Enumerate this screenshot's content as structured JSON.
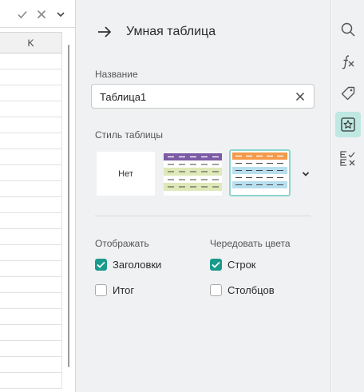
{
  "sheet": {
    "column_header": "K"
  },
  "panel": {
    "title": "Умная таблица",
    "name_label": "Название",
    "name_value": "Таблица1",
    "style_label": "Стиль таблицы",
    "style_none_label": "Нет",
    "display_label": "Отображать",
    "alternate_label": "Чередовать цвета",
    "checkboxes": {
      "headers": {
        "label": "Заголовки",
        "checked": true
      },
      "total": {
        "label": "Итог",
        "checked": false
      },
      "rows": {
        "label": "Строк",
        "checked": true
      },
      "columns": {
        "label": "Столбцов",
        "checked": false
      }
    }
  },
  "colors": {
    "accent": "#1a9a8c",
    "active_rail": "#bfe8e3",
    "style_purple_header": "#7b5aa6",
    "style_purple_band": "#dfe8b8",
    "style_orange_header": "#f39a4c",
    "style_orange_band": "#b8dff0"
  },
  "icons": {
    "formula_confirm": "check-icon",
    "formula_cancel": "close-icon",
    "formula_more": "chevron-down-icon",
    "back": "arrow-right-icon",
    "rail": [
      "search-icon",
      "function-icon",
      "tag-icon",
      "star-icon",
      "formula-check-icon"
    ]
  }
}
